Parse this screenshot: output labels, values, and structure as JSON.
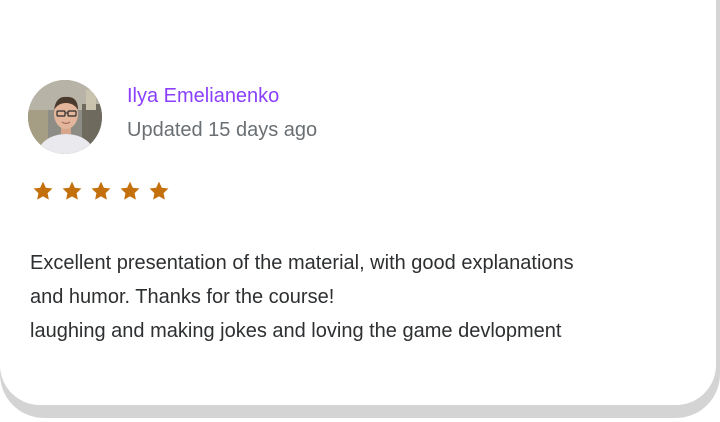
{
  "review": {
    "reviewer_name": "Ilya Emelianenko",
    "updated": "Updated 15 days ago",
    "rating": 5,
    "rating_max": 5,
    "lines": [
      "Excellent presentation of the material, with good explanations",
      "and humor. Thanks for the course!",
      "laughing and making jokes and loving the game devlopment"
    ],
    "avatar_icon": "user-avatar-photo",
    "star_icon": "star-icon"
  },
  "colors": {
    "name": "#8a3ffc",
    "date": "#6a6f73",
    "star": "#c4710d",
    "text": "#2d2f31"
  }
}
